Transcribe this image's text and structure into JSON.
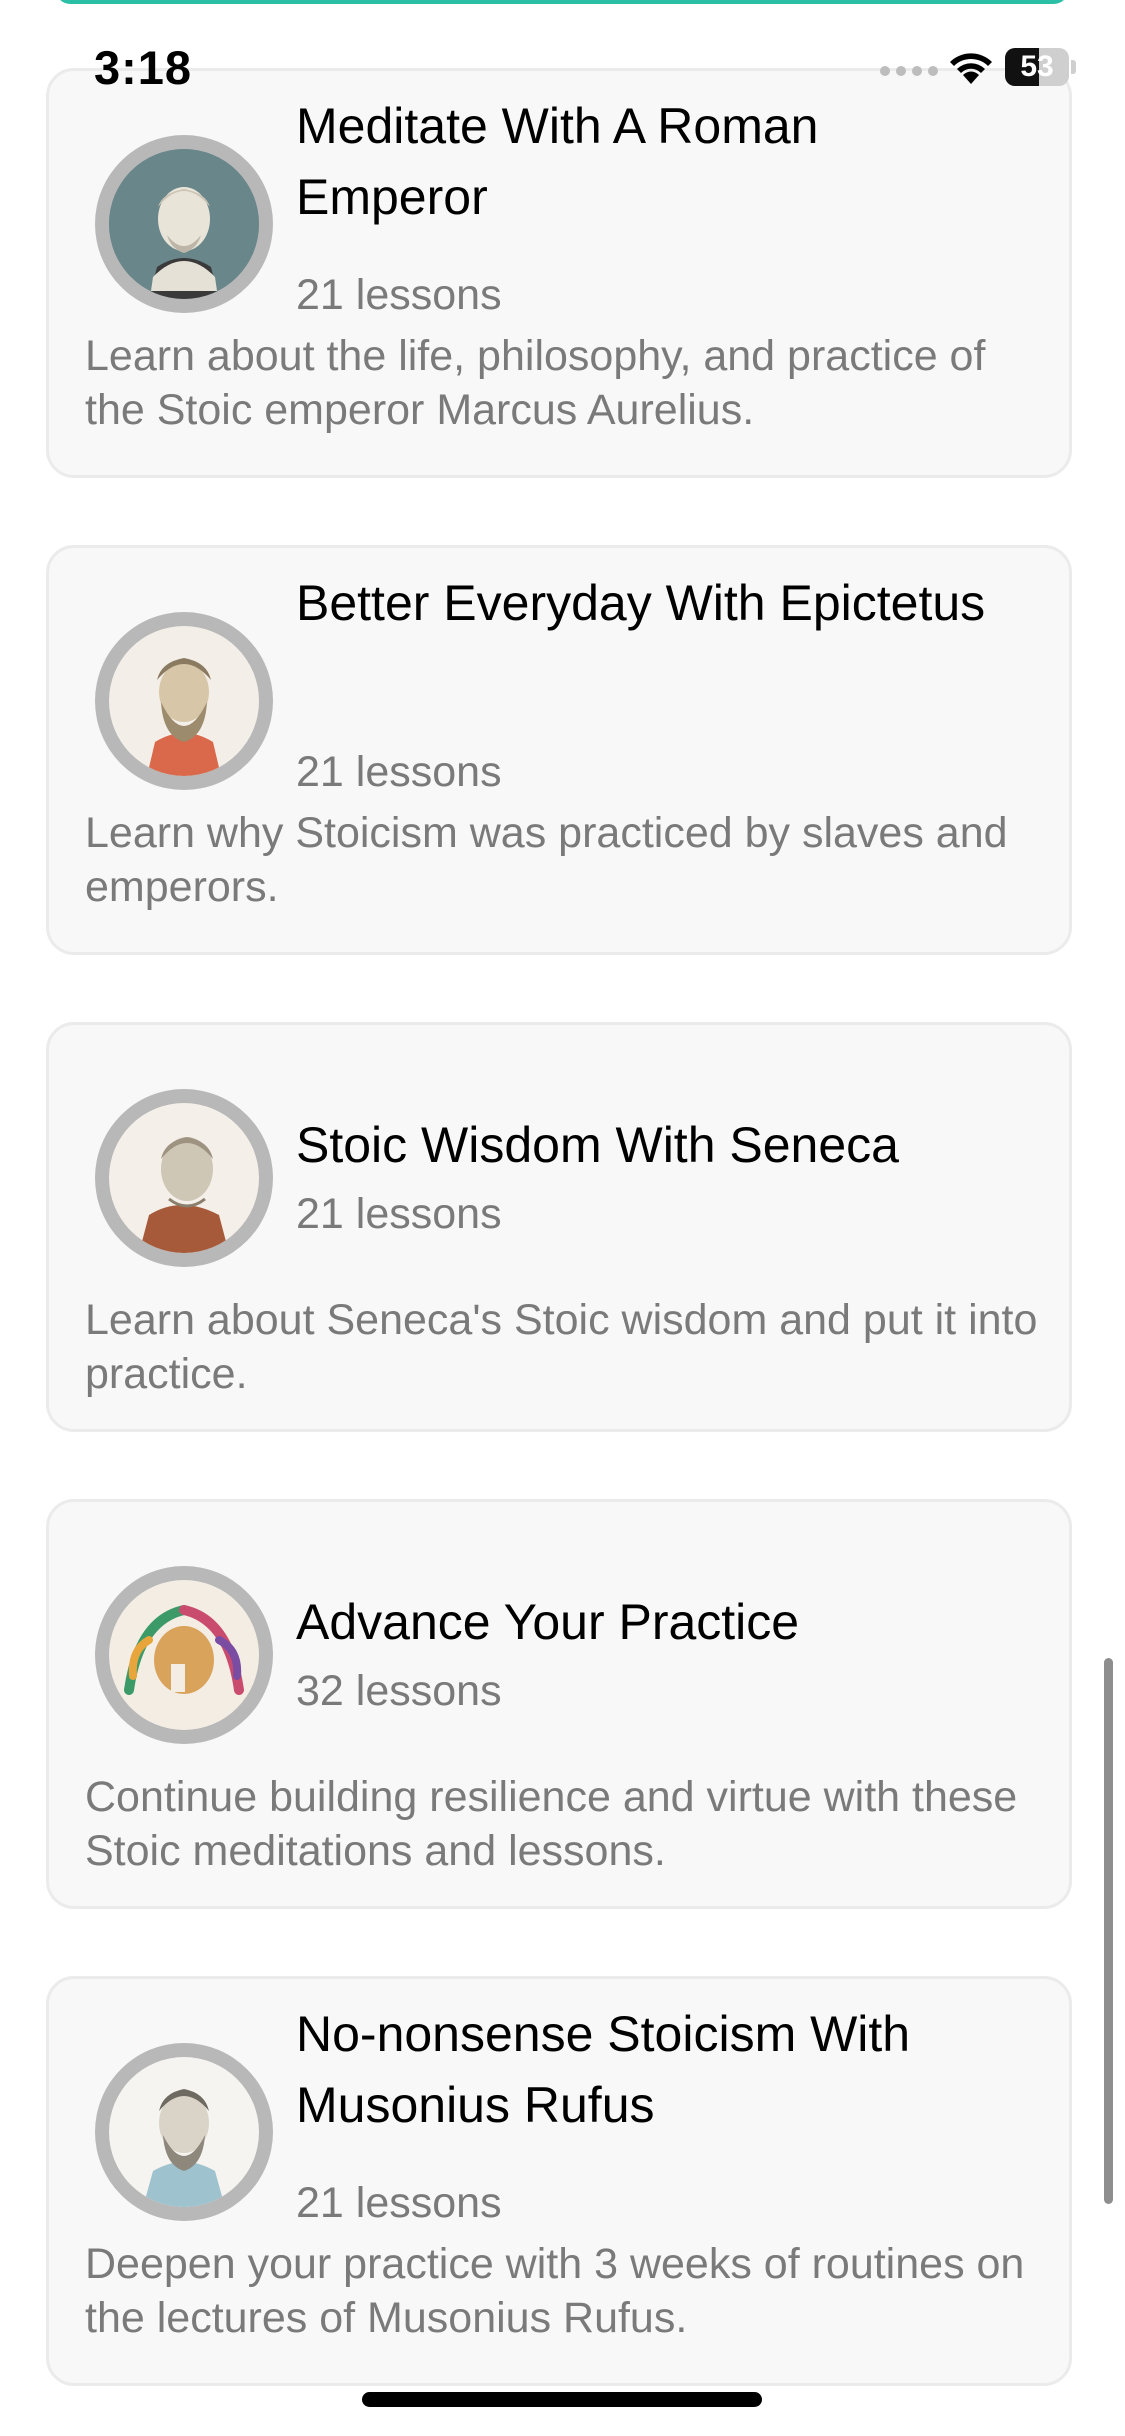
{
  "status_bar": {
    "time": "3:18",
    "battery_level": "53",
    "battery_fraction": 0.53
  },
  "courses": [
    {
      "title": "Meditate With A Roman Emperor",
      "lessons": "21 lessons",
      "description": "Learn about the life, philosophy, and practice of the Stoic emperor Marcus Aurelius.",
      "image": "marcus-aurelius-bust"
    },
    {
      "title": "Better Everyday With Epictetus",
      "lessons": "21 lessons",
      "description": "Learn why Stoicism was practiced by slaves and emperors.",
      "image": "epictetus-bust"
    },
    {
      "title": "Stoic Wisdom With Seneca",
      "lessons": "21 lessons",
      "description": "Learn about Seneca's Stoic wisdom and put it into practice.",
      "image": "seneca-bust"
    },
    {
      "title": "Advance Your Practice",
      "lessons": "32 lessons",
      "description": "Continue building resilience and virtue with these Stoic meditations and lessons.",
      "image": "spartan-helmet-laurel"
    },
    {
      "title": "No-nonsense Stoicism With Musonius Rufus",
      "lessons": "21 lessons",
      "description": "Deepen your practice with 3 weeks of routines on the lectures of Musonius Rufus.",
      "image": "musonius-rufus-sketch"
    }
  ]
}
